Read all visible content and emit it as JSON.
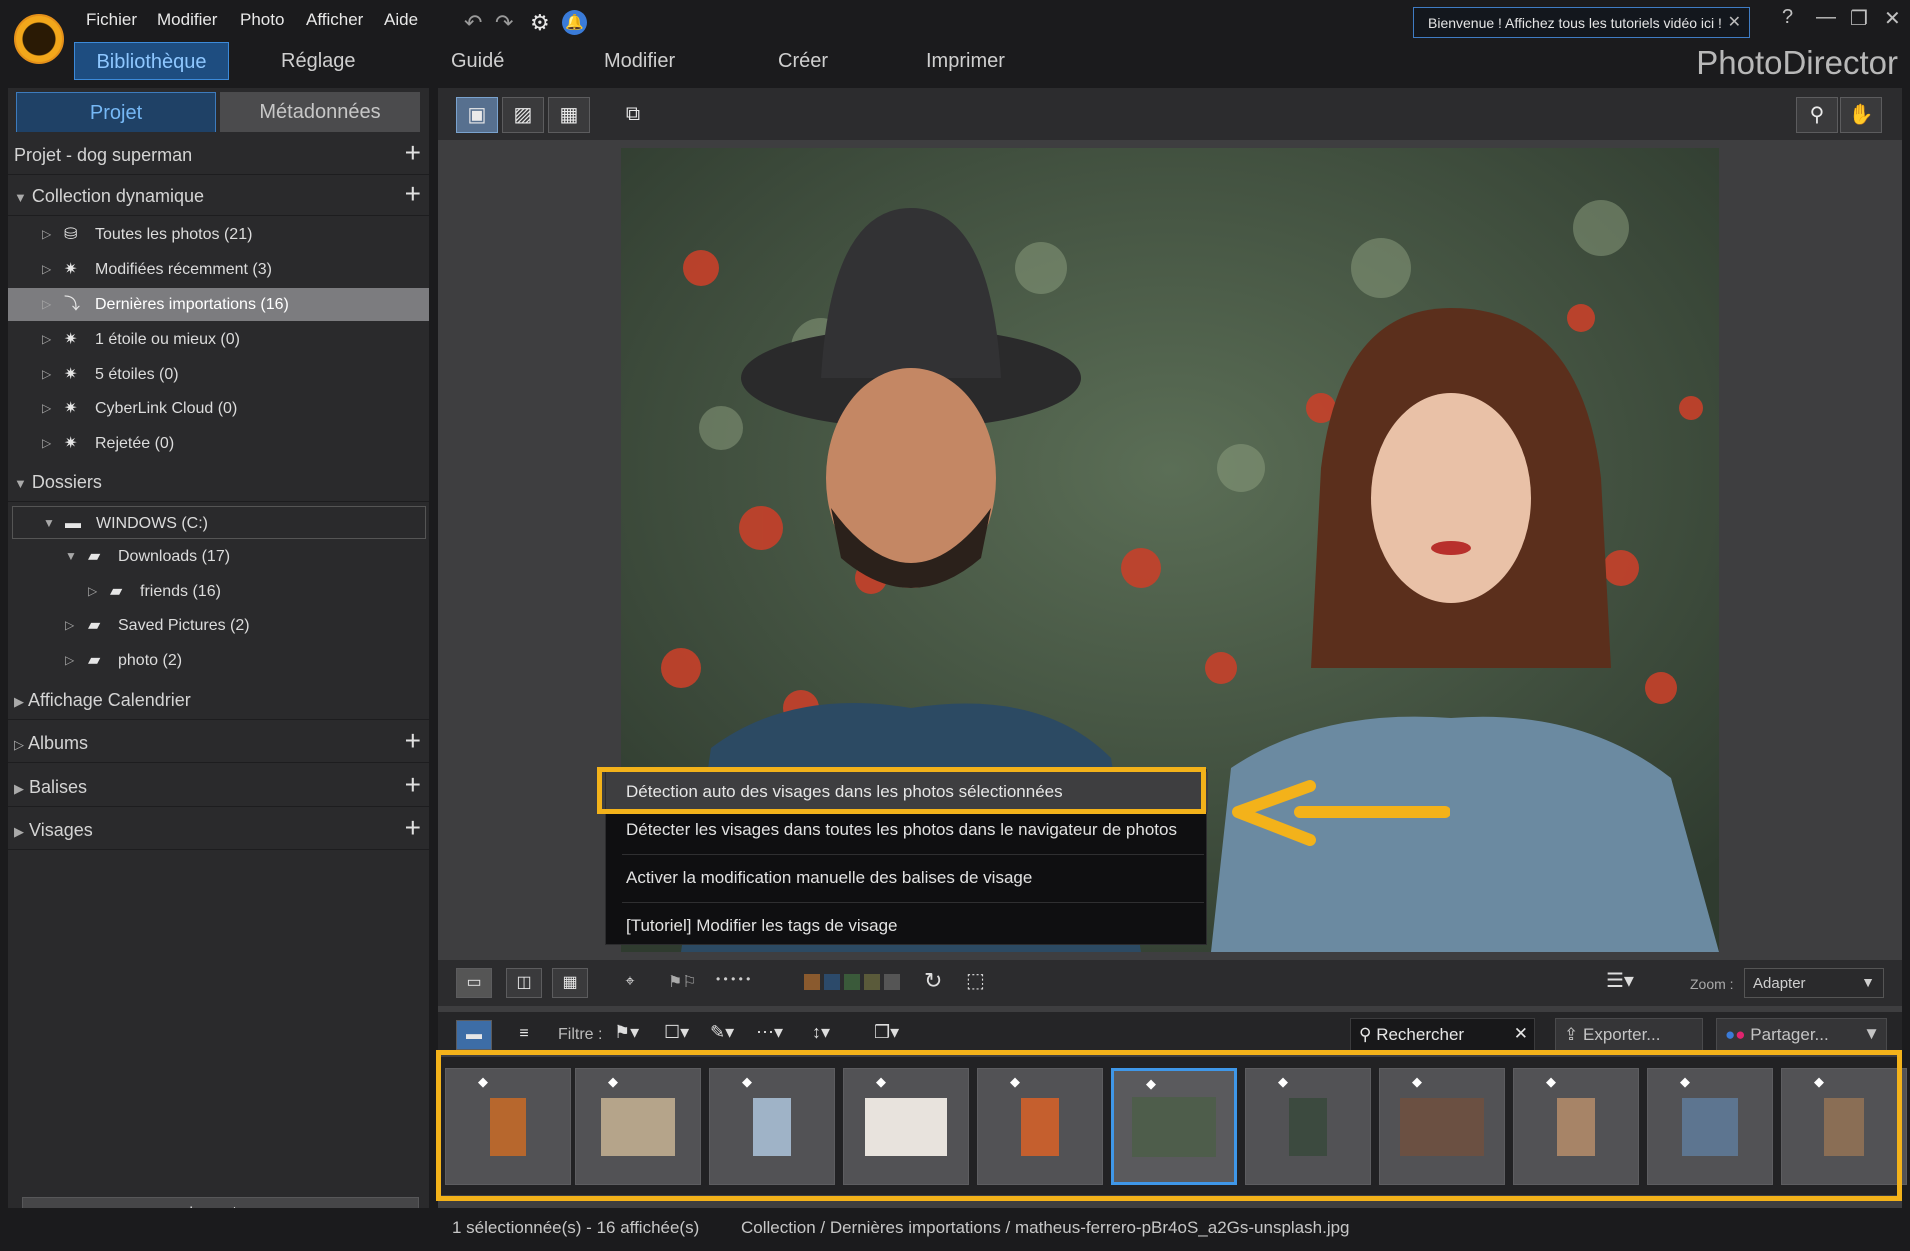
{
  "menubar": {
    "items": [
      "Fichier",
      "Modifier",
      "Photo",
      "Afficher",
      "Aide"
    ]
  },
  "welcome": {
    "text": "Bienvenue ! Affichez tous les tutoriels vidéo ici !"
  },
  "modes": {
    "items": [
      "Bibliothèque",
      "Réglage",
      "Guidé",
      "Modifier",
      "Créer",
      "Imprimer"
    ]
  },
  "brand": "PhotoDirector",
  "panel_tabs": {
    "projet": "Projet",
    "meta": "Métadonnées"
  },
  "project": {
    "title": "Projet - dog superman"
  },
  "dynamic": {
    "title": "Collection dynamique",
    "items": [
      "Toutes les photos (21)",
      "Modifiées récemment (3)",
      "Dernières importations (16)",
      "1 étoile ou mieux (0)",
      "5 étoiles (0)",
      "CyberLink Cloud (0)",
      "Rejetée (0)"
    ]
  },
  "folders": {
    "title": "Dossiers",
    "items": [
      "WINDOWS (C:)",
      "Downloads (17)",
      "friends (16)",
      "Saved Pictures (2)",
      "photo (2)"
    ]
  },
  "calendar": {
    "title": "Affichage Calendrier"
  },
  "albums": {
    "title": "Albums"
  },
  "tags": {
    "title": "Balises"
  },
  "faces": {
    "title": "Visages"
  },
  "import_label": "Importer",
  "context_menu": {
    "items": [
      "Détection auto des visages dans les photos sélectionnées",
      "Détecter les visages dans toutes les photos dans le navigateur de photos",
      "Activer la modification manuelle des balises de visage",
      "[Tutoriel] Modifier les tags de visage"
    ]
  },
  "bottom": {
    "zoom_label": "Zoom :",
    "zoom_value": "Adapter",
    "dots": "• • • • •"
  },
  "filter": {
    "label": "Filtre :",
    "search_placeholder": "Rechercher",
    "export_label": "Exporter...",
    "share_label": "Partager..."
  },
  "filmstrip": {
    "count": 11,
    "selected_index": 5
  },
  "status": {
    "selection": "1 sélectionnée(s) - 16 affichée(s)",
    "path": "Collection / Dernières importations / matheus-ferrero-pBr4oS_a2Gs-unsplash.jpg"
  },
  "colors": {
    "accent": "#f3b21a",
    "selected_border": "#3f97e8",
    "active_tab": "#1e4d80"
  },
  "icons": [
    "app-logo-icon",
    "undo-icon",
    "redo-icon",
    "settings-icon",
    "bell-icon",
    "help-icon",
    "minimize-icon",
    "restore-icon",
    "close-icon",
    "zoom-icon",
    "hand-icon",
    "rotate-icon",
    "tag-icon",
    "search-icon",
    "export-icon",
    "share-icon"
  ]
}
